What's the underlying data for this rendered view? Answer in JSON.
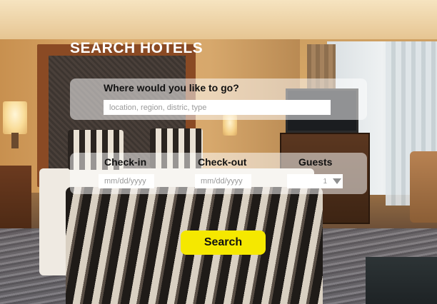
{
  "header": {
    "title": "SEARCH HOTELS"
  },
  "destination": {
    "label": "Where would you like to go?",
    "placeholder": "location, region, distric, type"
  },
  "dates": {
    "checkin_label": "Check-in",
    "checkin_placeholder": "mm/dd/yyyy",
    "checkout_label": "Check-out",
    "checkout_placeholder": "mm/dd/yyyy"
  },
  "guests": {
    "label": "Guests",
    "selected": "1",
    "arrow_icon": "triangle-down-icon"
  },
  "actions": {
    "search_label": "Search"
  },
  "colors": {
    "search_button": "#f5e800",
    "title_text": "#ffffff",
    "panel": "#ffffff"
  }
}
